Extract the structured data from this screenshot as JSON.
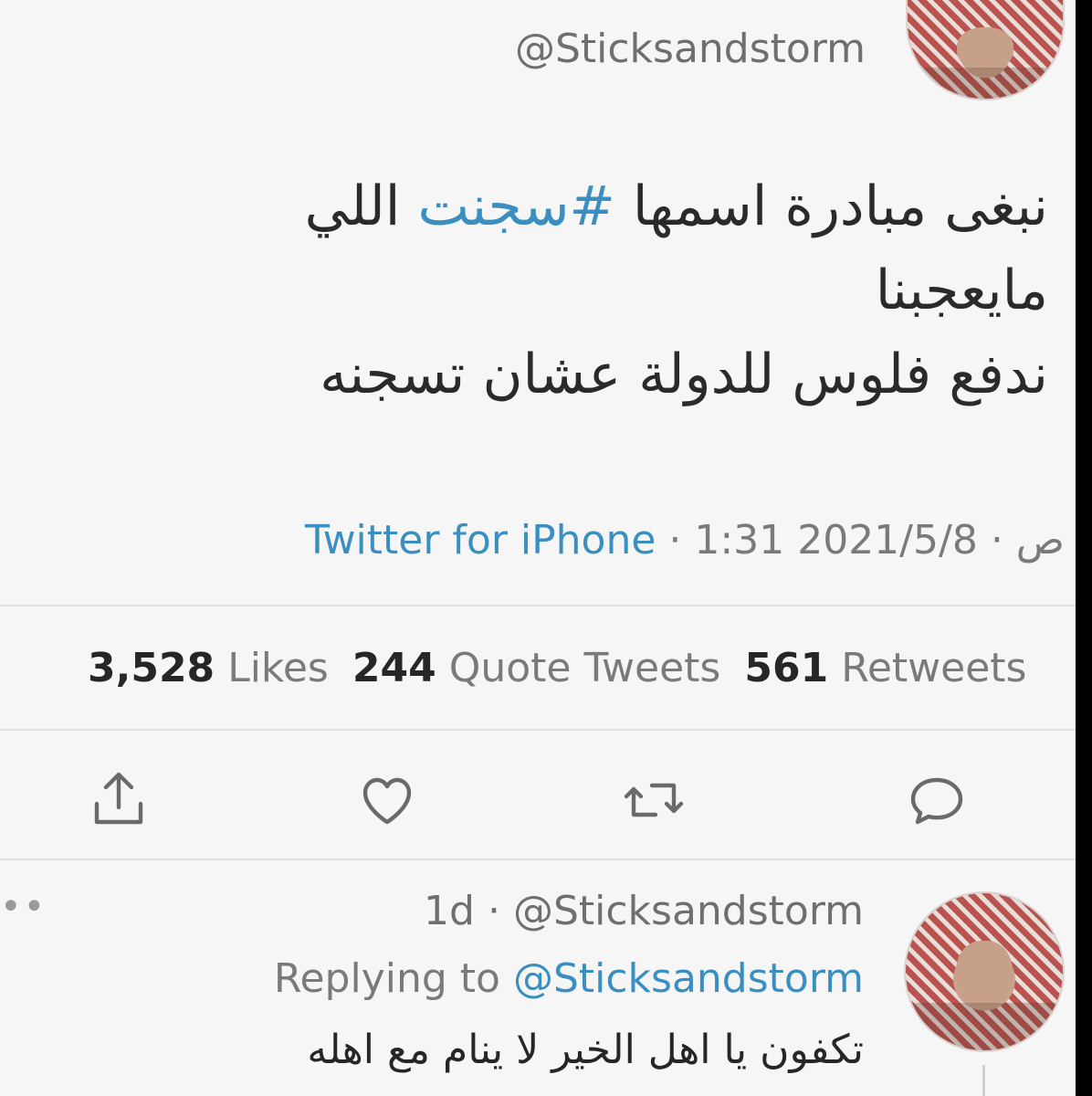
{
  "tweet": {
    "handle": "@Sticksandstorm",
    "text_line1_prefix": "نبغى مبادرة اسمها ",
    "hashtag": "#سجنت",
    "text_line1_suffix": " اللي مايعجبنا",
    "text_line2": "ندفع فلوس للدولة عشان تسجنه",
    "date": "2021/5/8",
    "time": "1:31 ص",
    "source": "Twitter for iPhone"
  },
  "stats": {
    "retweets_count": "561",
    "retweets_label": "Retweets",
    "quotes_count": "244",
    "quotes_label": "Quote Tweets",
    "likes_count": "3,528",
    "likes_label": "Likes"
  },
  "actions": [
    "reply-icon",
    "retweet-icon",
    "like-icon",
    "share-icon"
  ],
  "reply": {
    "age": "1d",
    "handle": "@Sticksandstorm",
    "replying_to_label": "Replying to",
    "replying_to_handle": "@Sticksandstorm",
    "text": "تكفون يا اهل الخير لا ينام مع اهله",
    "more": "••"
  },
  "colors": {
    "link": "#3a8fc0",
    "text": "#2a2a2a",
    "muted": "#7a7a7a",
    "background": "#f6f6f6"
  }
}
